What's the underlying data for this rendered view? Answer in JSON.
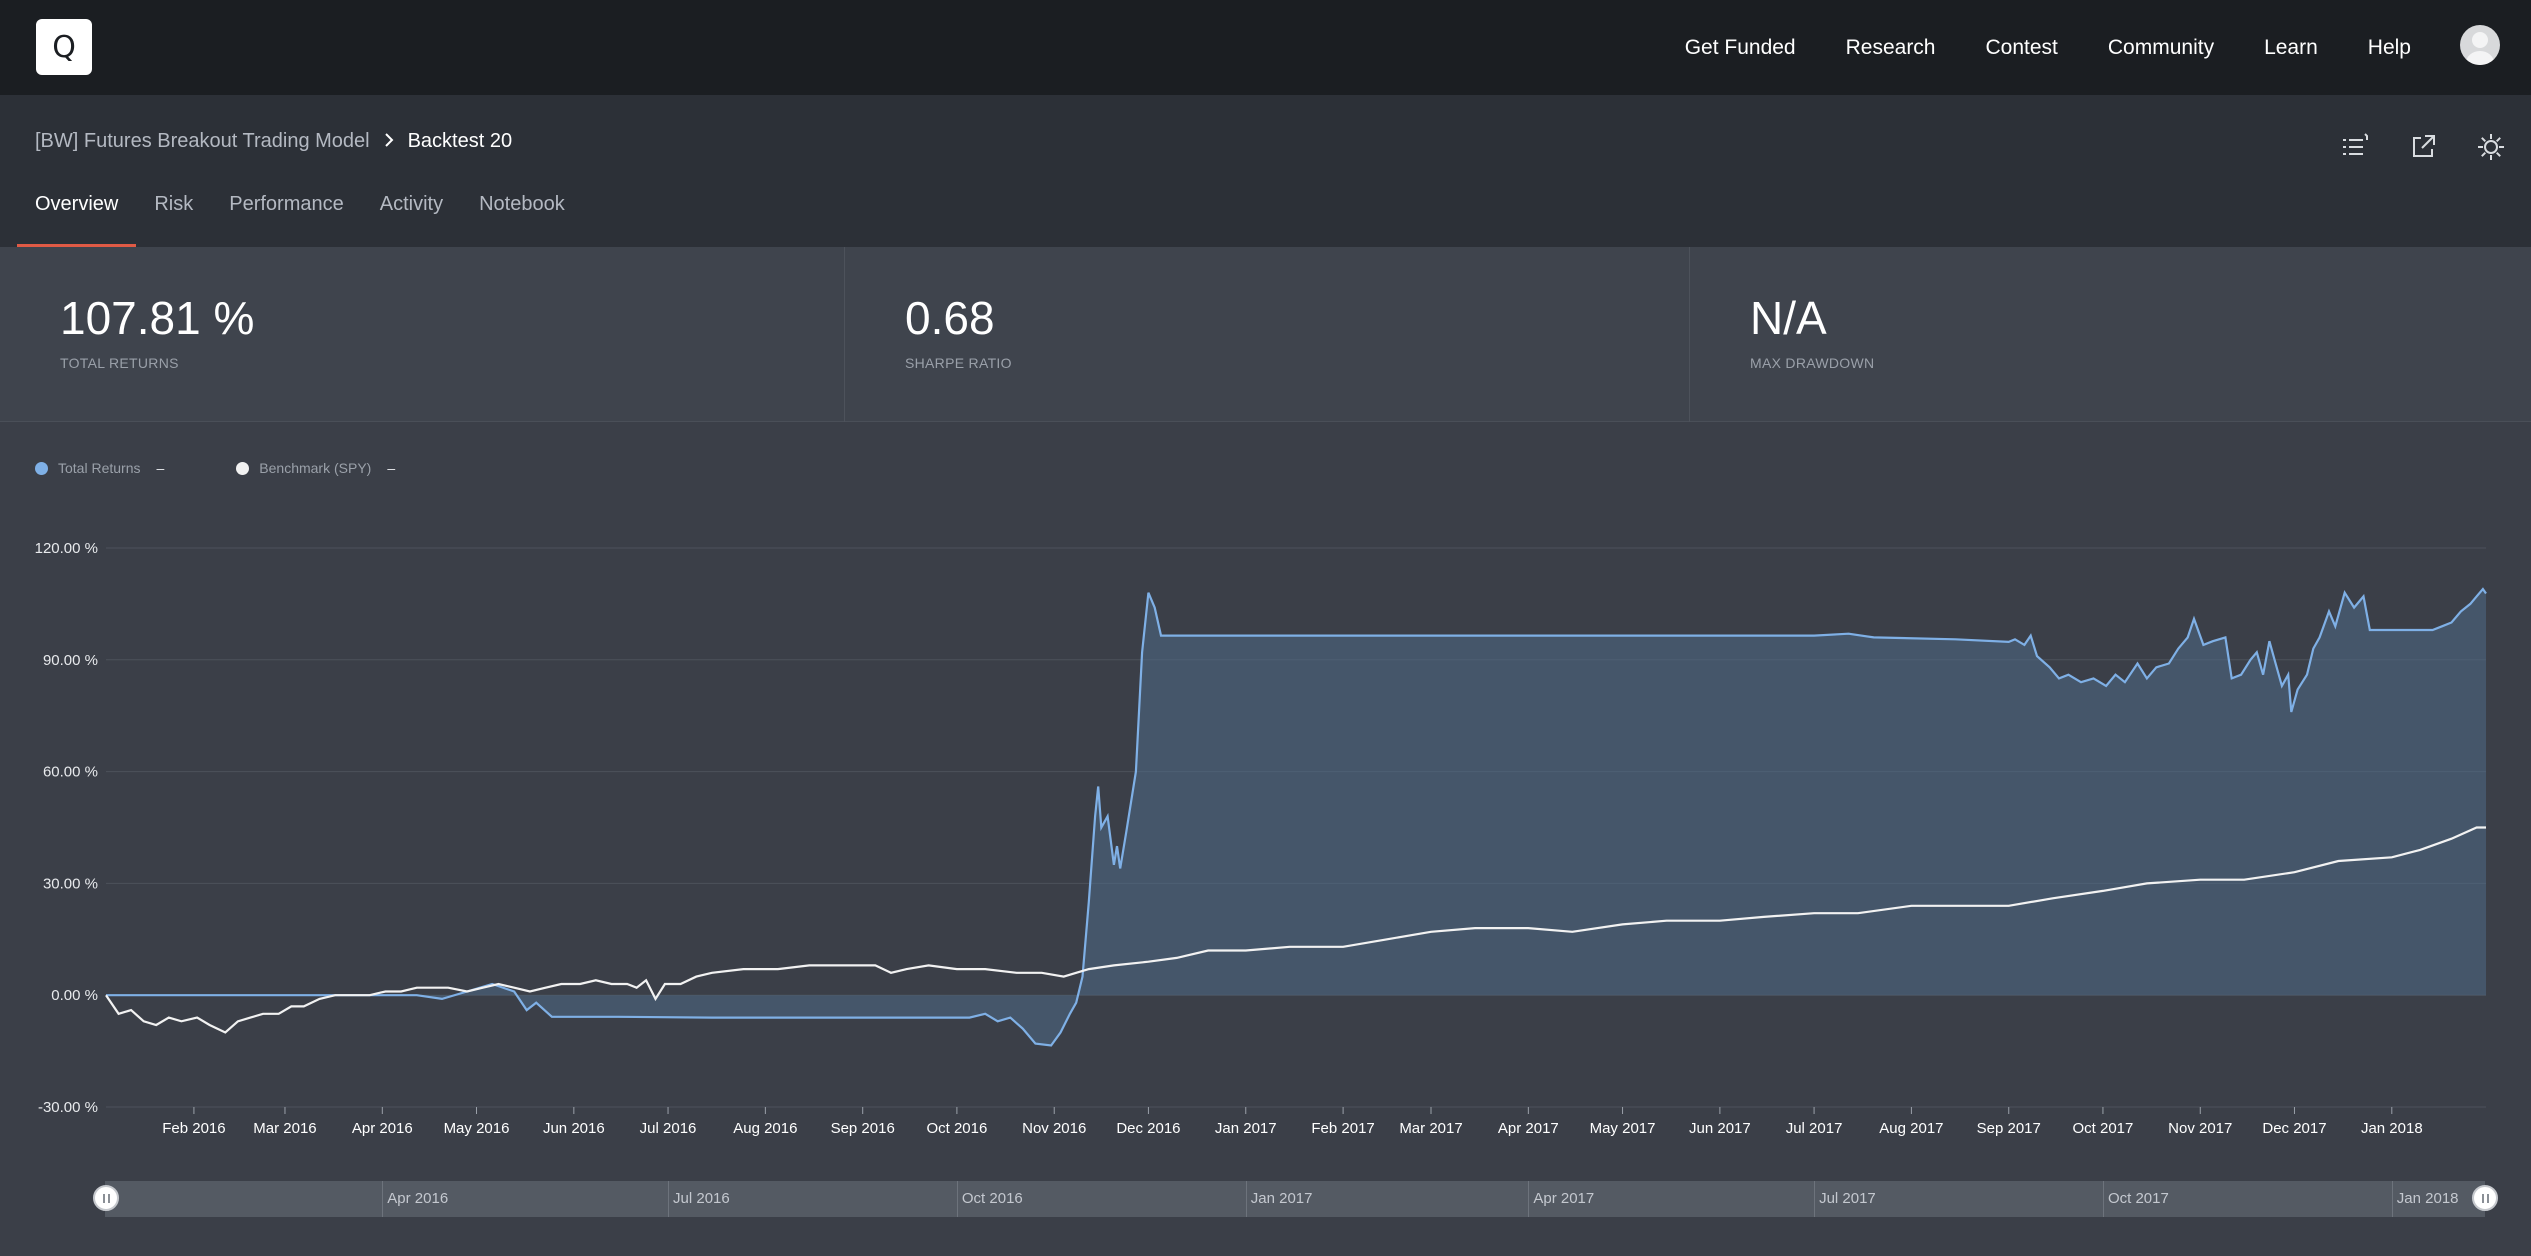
{
  "topbar": {
    "logo_letter": "Q",
    "nav": [
      "Get Funded",
      "Research",
      "Contest",
      "Community",
      "Learn",
      "Help"
    ]
  },
  "header": {
    "breadcrumb": {
      "model": "[BW] Futures Breakout Trading Model",
      "current": "Backtest 20"
    },
    "tabs": [
      "Overview",
      "Risk",
      "Performance",
      "Activity",
      "Notebook"
    ],
    "active_tab": "Overview",
    "tools": [
      "list-icon",
      "external-link-icon",
      "settings-icon"
    ]
  },
  "stats": [
    {
      "value": "107.81 %",
      "label": "TOTAL RETURNS"
    },
    {
      "value": "0.68",
      "label": "SHARPE RATIO"
    },
    {
      "value": "N/A",
      "label": "MAX DRAWDOWN"
    }
  ],
  "legend": [
    {
      "label": "Total Returns",
      "value": "–",
      "color": "#7fb0e6"
    },
    {
      "label": "Benchmark (SPY)",
      "value": "–",
      "color": "#f2f2f2"
    }
  ],
  "colors": {
    "accent": "#e05a45",
    "returns": "#7fb0e6",
    "benchmark": "#f2f2f2"
  },
  "chart_data": {
    "type": "area",
    "y_ticks": [
      "120.00 %",
      "90.00 %",
      "60.00 %",
      "30.00 %",
      "0.00 %",
      "-30.00 %"
    ],
    "ylim": [
      -30,
      120
    ],
    "x_ticks": [
      "Feb 2016",
      "Mar 2016",
      "Apr 2016",
      "May 2016",
      "Jun 2016",
      "Jul 2016",
      "Aug 2016",
      "Sep 2016",
      "Oct 2016",
      "Nov 2016",
      "Dec 2016",
      "Jan 2017",
      "Feb 2017",
      "Mar 2017",
      "Apr 2017",
      "May 2017",
      "Jun 2017",
      "Jul 2017",
      "Aug 2017",
      "Sep 2017",
      "Oct 2017",
      "Nov 2017",
      "Dec 2017",
      "Jan 2018"
    ],
    "xlim": [
      "2016-01-04",
      "2018-01-31"
    ],
    "grid": true,
    "series": [
      {
        "name": "Total Returns",
        "points": [
          [
            "2016-01-04",
            0
          ],
          [
            "2016-04-01",
            0
          ],
          [
            "2016-04-12",
            0
          ],
          [
            "2016-04-20",
            -1
          ],
          [
            "2016-04-28",
            1
          ],
          [
            "2016-05-06",
            3
          ],
          [
            "2016-05-13",
            1
          ],
          [
            "2016-05-17",
            -4
          ],
          [
            "2016-05-20",
            -2
          ],
          [
            "2016-05-25",
            -5.8
          ],
          [
            "2016-06-15",
            -5.8
          ],
          [
            "2016-07-15",
            -6
          ],
          [
            "2016-08-15",
            -6
          ],
          [
            "2016-09-15",
            -6
          ],
          [
            "2016-10-05",
            -6
          ],
          [
            "2016-10-10",
            -5
          ],
          [
            "2016-10-14",
            -7
          ],
          [
            "2016-10-18",
            -6
          ],
          [
            "2016-10-22",
            -9
          ],
          [
            "2016-10-26",
            -13
          ],
          [
            "2016-10-31",
            -13.5
          ],
          [
            "2016-11-03",
            -10
          ],
          [
            "2016-11-06",
            -5
          ],
          [
            "2016-11-08",
            -2
          ],
          [
            "2016-11-10",
            5
          ],
          [
            "2016-11-12",
            25
          ],
          [
            "2016-11-14",
            48
          ],
          [
            "2016-11-15",
            56
          ],
          [
            "2016-11-16",
            45
          ],
          [
            "2016-11-18",
            48
          ],
          [
            "2016-11-20",
            35
          ],
          [
            "2016-11-21",
            40
          ],
          [
            "2016-11-22",
            34
          ],
          [
            "2016-11-24",
            44
          ],
          [
            "2016-11-27",
            60
          ],
          [
            "2016-11-29",
            92
          ],
          [
            "2016-12-01",
            108
          ],
          [
            "2016-12-03",
            104
          ],
          [
            "2016-12-05",
            96.5
          ],
          [
            "2017-02-01",
            96.5
          ],
          [
            "2017-04-01",
            96.5
          ],
          [
            "2017-06-01",
            96.5
          ],
          [
            "2017-07-01",
            96.5
          ],
          [
            "2017-07-12",
            97
          ],
          [
            "2017-07-20",
            96
          ],
          [
            "2017-08-15",
            95.5
          ],
          [
            "2017-09-01",
            94.8
          ],
          [
            "2017-09-03",
            95.5
          ],
          [
            "2017-09-06",
            94
          ],
          [
            "2017-09-08",
            96.5
          ],
          [
            "2017-09-10",
            91
          ],
          [
            "2017-09-14",
            88
          ],
          [
            "2017-09-17",
            85
          ],
          [
            "2017-09-20",
            86
          ],
          [
            "2017-09-24",
            84
          ],
          [
            "2017-09-28",
            85
          ],
          [
            "2017-10-02",
            83
          ],
          [
            "2017-10-05",
            86
          ],
          [
            "2017-10-08",
            84
          ],
          [
            "2017-10-12",
            89
          ],
          [
            "2017-10-15",
            85
          ],
          [
            "2017-10-18",
            88
          ],
          [
            "2017-10-22",
            89
          ],
          [
            "2017-10-25",
            93
          ],
          [
            "2017-10-28",
            96
          ],
          [
            "2017-10-30",
            101
          ],
          [
            "2017-11-02",
            94
          ],
          [
            "2017-11-05",
            95
          ],
          [
            "2017-11-09",
            96
          ],
          [
            "2017-11-11",
            85
          ],
          [
            "2017-11-14",
            86
          ],
          [
            "2017-11-17",
            90
          ],
          [
            "2017-11-19",
            92
          ],
          [
            "2017-11-21",
            86
          ],
          [
            "2017-11-23",
            95
          ],
          [
            "2017-11-25",
            89
          ],
          [
            "2017-11-27",
            83
          ],
          [
            "2017-11-29",
            86
          ],
          [
            "2017-11-30",
            76
          ],
          [
            "2017-12-02",
            82
          ],
          [
            "2017-12-05",
            86
          ],
          [
            "2017-12-07",
            93
          ],
          [
            "2017-12-09",
            96
          ],
          [
            "2017-12-12",
            103
          ],
          [
            "2017-12-14",
            99
          ],
          [
            "2017-12-17",
            108
          ],
          [
            "2017-12-20",
            104
          ],
          [
            "2017-12-23",
            107
          ],
          [
            "2017-12-25",
            98
          ],
          [
            "2018-01-01",
            98
          ],
          [
            "2018-01-08",
            98
          ],
          [
            "2018-01-10",
            98
          ],
          [
            "2018-01-14",
            98
          ],
          [
            "2018-01-17",
            99
          ],
          [
            "2018-01-20",
            100
          ],
          [
            "2018-01-23",
            103
          ],
          [
            "2018-01-26",
            105
          ],
          [
            "2018-01-28",
            107
          ],
          [
            "2018-01-30",
            109
          ],
          [
            "2018-01-31",
            107.8
          ]
        ]
      },
      {
        "name": "Benchmark (SPY)",
        "points": [
          [
            "2016-01-04",
            0
          ],
          [
            "2016-01-08",
            -5
          ],
          [
            "2016-01-12",
            -4
          ],
          [
            "2016-01-16",
            -7
          ],
          [
            "2016-01-20",
            -8
          ],
          [
            "2016-01-24",
            -6
          ],
          [
            "2016-01-28",
            -7
          ],
          [
            "2016-02-02",
            -6
          ],
          [
            "2016-02-06",
            -8
          ],
          [
            "2016-02-11",
            -10
          ],
          [
            "2016-02-15",
            -7
          ],
          [
            "2016-02-19",
            -6
          ],
          [
            "2016-02-23",
            -5
          ],
          [
            "2016-02-28",
            -5
          ],
          [
            "2016-03-03",
            -3
          ],
          [
            "2016-03-07",
            -3
          ],
          [
            "2016-03-12",
            -1
          ],
          [
            "2016-03-17",
            0
          ],
          [
            "2016-03-22",
            0
          ],
          [
            "2016-03-28",
            0
          ],
          [
            "2016-04-02",
            1
          ],
          [
            "2016-04-07",
            1
          ],
          [
            "2016-04-12",
            2
          ],
          [
            "2016-04-18",
            2
          ],
          [
            "2016-04-22",
            2
          ],
          [
            "2016-04-28",
            1
          ],
          [
            "2016-05-03",
            2
          ],
          [
            "2016-05-08",
            3
          ],
          [
            "2016-05-13",
            2
          ],
          [
            "2016-05-18",
            1
          ],
          [
            "2016-05-23",
            2
          ],
          [
            "2016-05-28",
            3
          ],
          [
            "2016-06-03",
            3
          ],
          [
            "2016-06-08",
            4
          ],
          [
            "2016-06-13",
            3
          ],
          [
            "2016-06-18",
            3
          ],
          [
            "2016-06-21",
            2
          ],
          [
            "2016-06-24",
            4
          ],
          [
            "2016-06-27",
            -1
          ],
          [
            "2016-06-30",
            3
          ],
          [
            "2016-07-05",
            3
          ],
          [
            "2016-07-10",
            5
          ],
          [
            "2016-07-15",
            6
          ],
          [
            "2016-07-25",
            7
          ],
          [
            "2016-08-05",
            7
          ],
          [
            "2016-08-15",
            8
          ],
          [
            "2016-08-25",
            8
          ],
          [
            "2016-09-05",
            8
          ],
          [
            "2016-09-10",
            6
          ],
          [
            "2016-09-15",
            7
          ],
          [
            "2016-09-22",
            8
          ],
          [
            "2016-10-01",
            7
          ],
          [
            "2016-10-10",
            7
          ],
          [
            "2016-10-20",
            6
          ],
          [
            "2016-10-28",
            6
          ],
          [
            "2016-11-04",
            5
          ],
          [
            "2016-11-08",
            6
          ],
          [
            "2016-11-12",
            7
          ],
          [
            "2016-11-20",
            8
          ],
          [
            "2016-12-01",
            9
          ],
          [
            "2016-12-10",
            10
          ],
          [
            "2016-12-20",
            12
          ],
          [
            "2017-01-01",
            12
          ],
          [
            "2017-01-15",
            13
          ],
          [
            "2017-02-01",
            13
          ],
          [
            "2017-02-15",
            15
          ],
          [
            "2017-03-01",
            17
          ],
          [
            "2017-03-15",
            18
          ],
          [
            "2017-04-01",
            18
          ],
          [
            "2017-04-15",
            17
          ],
          [
            "2017-05-01",
            19
          ],
          [
            "2017-05-15",
            20
          ],
          [
            "2017-06-01",
            20
          ],
          [
            "2017-06-15",
            21
          ],
          [
            "2017-07-01",
            22
          ],
          [
            "2017-07-15",
            22
          ],
          [
            "2017-08-01",
            24
          ],
          [
            "2017-08-15",
            24
          ],
          [
            "2017-09-01",
            24
          ],
          [
            "2017-09-15",
            26
          ],
          [
            "2017-10-01",
            28
          ],
          [
            "2017-10-15",
            30
          ],
          [
            "2017-11-01",
            31
          ],
          [
            "2017-11-15",
            31
          ],
          [
            "2017-12-01",
            33
          ],
          [
            "2017-12-15",
            36
          ],
          [
            "2018-01-01",
            37
          ],
          [
            "2018-01-10",
            39
          ],
          [
            "2018-01-20",
            42
          ],
          [
            "2018-01-28",
            45
          ],
          [
            "2018-01-31",
            45
          ]
        ]
      }
    ]
  },
  "scrubber": {
    "ticks": [
      "Apr 2016",
      "Jul 2016",
      "Oct 2016",
      "Jan 2017",
      "Apr 2017",
      "Jul 2017",
      "Oct 2017",
      "Jan 2018"
    ]
  }
}
